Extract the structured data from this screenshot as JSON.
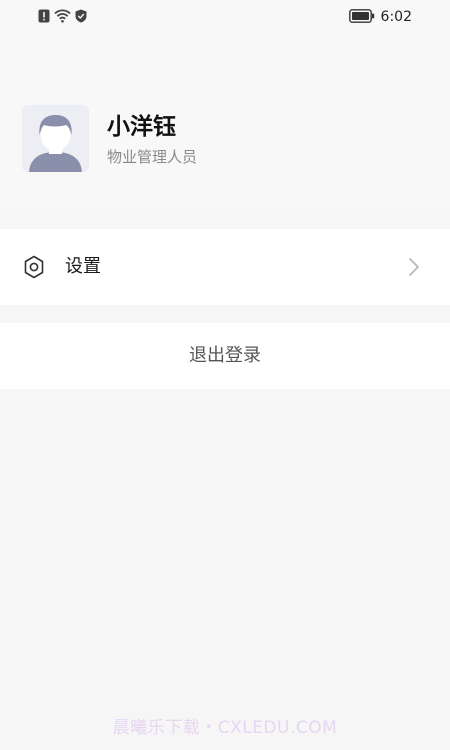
{
  "status_bar": {
    "time": "6:02",
    "icons": [
      "alert-icon",
      "wifi-icon",
      "shield-icon",
      "battery-icon"
    ]
  },
  "profile": {
    "name": "小洋钰",
    "role": "物业管理人员",
    "avatar_icon": "default-avatar-icon"
  },
  "menu": {
    "settings": {
      "label": "设置",
      "icon": "gear-icon"
    }
  },
  "logout": {
    "label": "退出登录"
  },
  "watermark": {
    "text": "晨曦乐下载・CXLEDU.COM"
  },
  "colors": {
    "background": "#f6f6f6",
    "card": "#ffffff",
    "title_text": "#111111",
    "secondary_text": "#8a8a8a",
    "avatar_bg": "#eceef3",
    "avatar_figure": "#8a8fab"
  }
}
